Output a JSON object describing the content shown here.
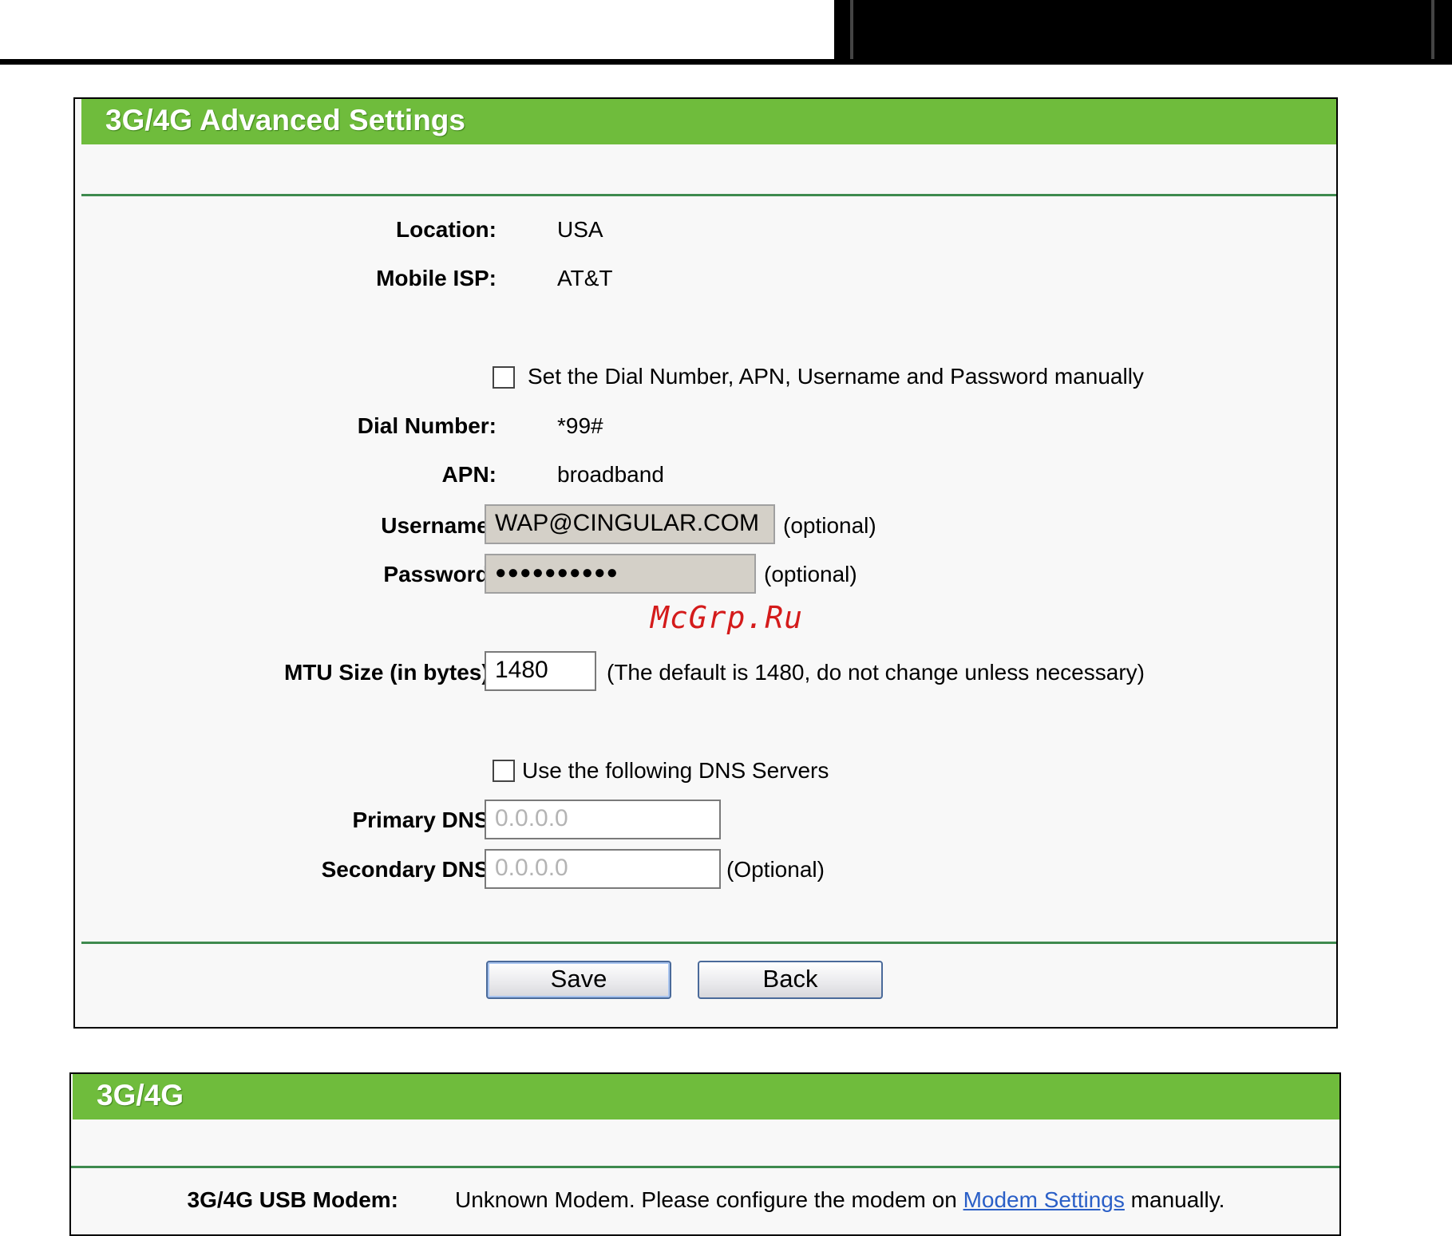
{
  "advanced": {
    "title": "3G/4G Advanced Settings",
    "location_label": "Location:",
    "location_value": "USA",
    "isp_label": "Mobile ISP:",
    "isp_value": "AT&T",
    "manual_checkbox_label": "Set the Dial Number, APN, Username and Password manually",
    "manual_checked": false,
    "dial_label": "Dial Number:",
    "dial_value": "*99#",
    "apn_label": "APN:",
    "apn_value": "broadband",
    "username_label": "Username:",
    "username_value": "WAP@CINGULAR.COM",
    "username_note": "(optional)",
    "password_label": "Password:",
    "password_value": "●●●●●●●●●●",
    "password_note": "(optional)",
    "mtu_label": "MTU Size (in bytes):",
    "mtu_value": "1480",
    "mtu_note": "(The default is 1480, do not change unless necessary)",
    "dns_checkbox_label": "Use the following DNS Servers",
    "dns_checked": false,
    "primary_dns_label": "Primary DNS:",
    "primary_dns_value": "0.0.0.0",
    "secondary_dns_label": "Secondary DNS:",
    "secondary_dns_value": "0.0.0.0",
    "secondary_dns_note": "(Optional)",
    "save_label": "Save",
    "back_label": "Back"
  },
  "basic": {
    "title": "3G/4G",
    "modem_label": "3G/4G USB Modem:",
    "modem_text_before": "Unknown Modem. Please configure the modem on ",
    "modem_link": "Modem Settings",
    "modem_text_after": " manually."
  },
  "watermark": "McGrp.Ru",
  "colors": {
    "header_green": "#6fbc3c",
    "rule_green": "#3e8a4e",
    "link_blue": "#2a5fc7",
    "watermark_red": "#d41b1b"
  }
}
